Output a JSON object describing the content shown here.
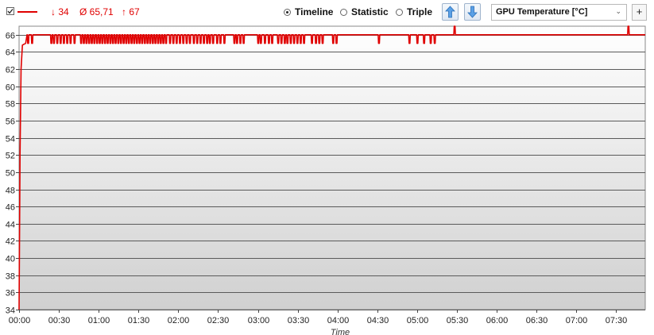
{
  "toolbar": {
    "min_label": "↓ 34",
    "avg_label": "Ø 65,71",
    "max_label": "↑ 67",
    "series_color": "#e00000",
    "view_modes": [
      {
        "label": "Timeline",
        "selected": true
      },
      {
        "label": "Statistic",
        "selected": false
      },
      {
        "label": "Triple",
        "selected": false
      }
    ],
    "up_icon": "arrow-up-icon",
    "down_icon": "arrow-down-icon",
    "sensor_select": "GPU Temperature [°C]",
    "add_label": "+"
  },
  "chart_data": {
    "type": "line",
    "xlabel": "Time",
    "ylabel": "",
    "x_unit": "minutes",
    "xlim": [
      0,
      472
    ],
    "ylim": [
      34,
      67
    ],
    "y_ticks": [
      34,
      36,
      38,
      40,
      42,
      44,
      46,
      48,
      50,
      52,
      54,
      56,
      58,
      60,
      62,
      64,
      66
    ],
    "x_ticks": [
      {
        "t": 0,
        "label": "00:00"
      },
      {
        "t": 30,
        "label": "00:30"
      },
      {
        "t": 60,
        "label": "01:00"
      },
      {
        "t": 90,
        "label": "01:30"
      },
      {
        "t": 120,
        "label": "02:00"
      },
      {
        "t": 150,
        "label": "02:30"
      },
      {
        "t": 180,
        "label": "03:00"
      },
      {
        "t": 210,
        "label": "03:30"
      },
      {
        "t": 240,
        "label": "04:00"
      },
      {
        "t": 270,
        "label": "04:30"
      },
      {
        "t": 300,
        "label": "05:00"
      },
      {
        "t": 330,
        "label": "05:30"
      },
      {
        "t": 360,
        "label": "06:00"
      },
      {
        "t": 390,
        "label": "06:30"
      },
      {
        "t": 420,
        "label": "07:00"
      },
      {
        "t": 450,
        "label": "07:30"
      }
    ],
    "grid": true,
    "series": [
      {
        "color": "#e00000",
        "baseline": 66,
        "ramp": [
          [
            0,
            34
          ],
          [
            0.7,
            52
          ],
          [
            1.5,
            62
          ],
          [
            2.5,
            64.8
          ],
          [
            5,
            65
          ],
          [
            6,
            66
          ]
        ],
        "dips_to": 65,
        "dip_times": [
          6.5,
          9.5,
          24,
          26,
          28.5,
          31,
          33.5,
          36,
          38.5,
          41.5,
          46.5,
          48.5,
          50.5,
          52.5,
          54.5,
          56.5,
          58.5,
          60.5,
          62.5,
          64.5,
          66.5,
          68.5,
          70.5,
          72.5,
          74.5,
          76.5,
          78.5,
          80.5,
          82.5,
          84.5,
          86.5,
          88.5,
          90.5,
          92.5,
          94.5,
          96.5,
          98.5,
          100.5,
          102.5,
          104.5,
          106.5,
          108.5,
          110.5,
          113.5,
          116,
          118.5,
          121,
          123.5,
          126,
          128.5,
          131.5,
          134,
          136.5,
          139,
          141.5,
          143.5,
          146,
          149,
          151.5,
          154.5,
          162,
          164,
          166.5,
          169,
          180,
          182,
          185,
          188,
          190.5,
          195,
          197.5,
          200,
          202,
          204.5,
          207,
          209.5,
          212,
          214.5,
          220.5,
          223.5,
          226,
          228.5,
          236.5,
          239,
          271,
          294,
          300,
          305,
          310,
          313
        ],
        "spikes_to": 67,
        "spike_times": [
          328,
          459
        ]
      }
    ]
  }
}
